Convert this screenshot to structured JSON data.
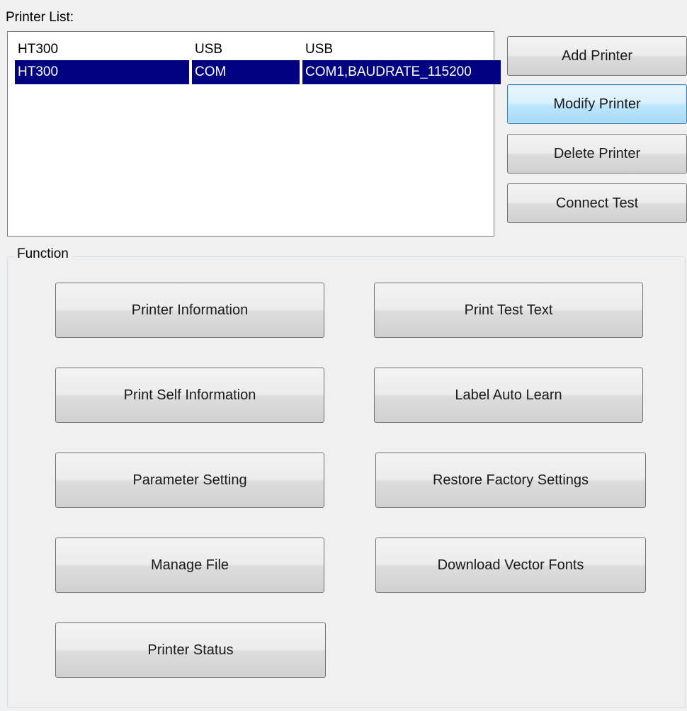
{
  "printer_list": {
    "label": "Printer List:",
    "rows": [
      {
        "name": "HT300",
        "interface": "USB",
        "port": "USB",
        "selected": false
      },
      {
        "name": "HT300",
        "interface": "COM",
        "port": "COM1,BAUDRATE_115200",
        "selected": true
      }
    ]
  },
  "side_buttons": {
    "add": "Add Printer",
    "modify": "Modify Printer",
    "delete": "Delete Printer",
    "connect": "Connect Test"
  },
  "function": {
    "title": "Function",
    "printer_information": "Printer Information",
    "print_test_text": "Print Test Text",
    "print_self_information": "Print Self Information",
    "label_auto_learn": "Label Auto Learn",
    "parameter_setting": "Parameter Setting",
    "restore_factory_settings": "Restore Factory Settings",
    "manage_file": "Manage File",
    "download_vector_fonts": "Download Vector Fonts",
    "printer_status": "Printer Status"
  },
  "colors": {
    "selection": "#000080",
    "focus_border": "#3c7fb1"
  }
}
